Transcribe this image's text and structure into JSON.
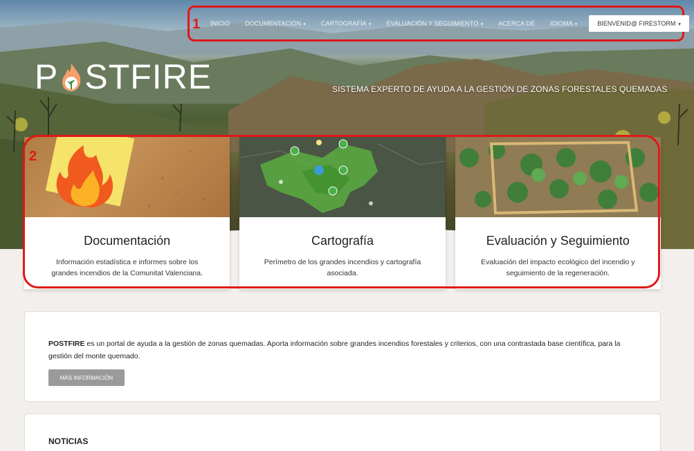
{
  "nav": {
    "items": [
      {
        "label": "INICIO",
        "dropdown": false
      },
      {
        "label": "DOCUMENTACIÓN",
        "dropdown": true
      },
      {
        "label": "CARTOGRAFÍA",
        "dropdown": true
      },
      {
        "label": "EVALUACIÓN Y SEGUIMIENTO",
        "dropdown": true
      },
      {
        "label": "ACERCA DE",
        "dropdown": false
      },
      {
        "label": "IDIOMA",
        "dropdown": true
      }
    ],
    "user_label": "BIENVENID@ FIRESTORM"
  },
  "annotations": {
    "nav_number": "1",
    "cards_number": "2",
    "color": "#e01818"
  },
  "hero": {
    "logo_left": "P",
    "logo_right": "STFIRE",
    "tagline": "SISTEMA EXPERTO DE AYUDA A LA GESTIÓN DE ZONAS FORESTALES QUEMADAS"
  },
  "cards": [
    {
      "title": "Documentación",
      "description": "Información estadística e informes sobre los grandes incendios de la Comunitat Valenciana."
    },
    {
      "title": "Cartografía",
      "description": "Perímetro de los grandes incendios y cartografía asociada."
    },
    {
      "title": "Evaluación y Seguimiento",
      "description": "Evaluación del impacto ecológico del incendio y seguimiento de la regeneración."
    }
  ],
  "info": {
    "brand": "POSTFIRE",
    "text": " es un portal de ayuda a la gestión de zonas quemadas. Aporta información sobre grandes incendios forestales y criterios, con una contrastada base científica, para la gestión del monte quemado.",
    "button": "MÁS INFORMACIÓN"
  },
  "news": {
    "title": "NOTICIAS"
  }
}
